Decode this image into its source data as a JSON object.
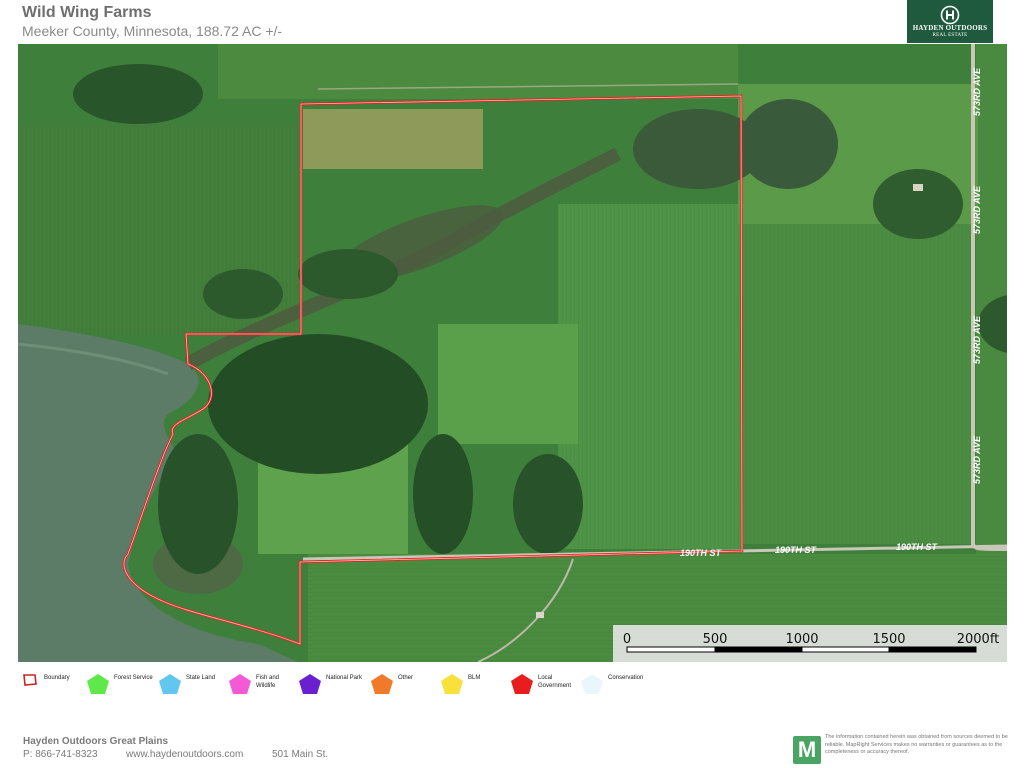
{
  "header": {
    "title": "Wild Wing Farms",
    "subtitle": "Meeker County, Minnesota, 188.72 AC +/-",
    "logo_name": "HAYDEN OUTDOORS",
    "logo_sub": "REAL ESTATE",
    "logo_colors": {
      "background": "#1f5a3e",
      "text": "#ffffff"
    }
  },
  "map": {
    "boundary_color": "#e8201e",
    "road_labels": [
      "573RD AVE",
      "573RD AVE",
      "573RD AVE",
      "573RD AVE",
      "190TH ST",
      "190TH ST",
      "190TH ST"
    ],
    "scale_bar": {
      "ticks": [
        "0",
        "500",
        "1000",
        "1500",
        "2000ft"
      ]
    }
  },
  "legend": [
    {
      "label": "Boundary",
      "color": "#c62828",
      "icon": "boundary-outline-icon"
    },
    {
      "label": "Forest Service",
      "color": "#5ee84a",
      "icon": "pentagon-icon"
    },
    {
      "label": "State Land",
      "color": "#62c7ee",
      "icon": "pentagon-icon"
    },
    {
      "label": "Fish and Wildlife",
      "color": "#f45ad6",
      "icon": "pentagon-icon"
    },
    {
      "label": "National Park",
      "color": "#6a1fd0",
      "icon": "pentagon-icon"
    },
    {
      "label": "Other",
      "color": "#f07a2a",
      "icon": "pentagon-icon"
    },
    {
      "label": "BLM",
      "color": "#f7e13a",
      "icon": "pentagon-icon"
    },
    {
      "label": "Local Government",
      "color": "#e81e1e",
      "icon": "pentagon-icon"
    },
    {
      "label": "Conservation",
      "color": "#e9f6fb",
      "icon": "pentagon-icon"
    }
  ],
  "footer": {
    "company": "Hayden Outdoors Great Plains",
    "phone": "P: 866-741-8323",
    "website": "www.haydenoutdoors.com",
    "address": "501 Main St.",
    "mapright_logo_letter": "M",
    "disclaimer": "The information contained herein was obtained from sources deemed to be reliable. MapRight Services makes no warranties or guarantees as to the completeness or accuracy thereof."
  }
}
